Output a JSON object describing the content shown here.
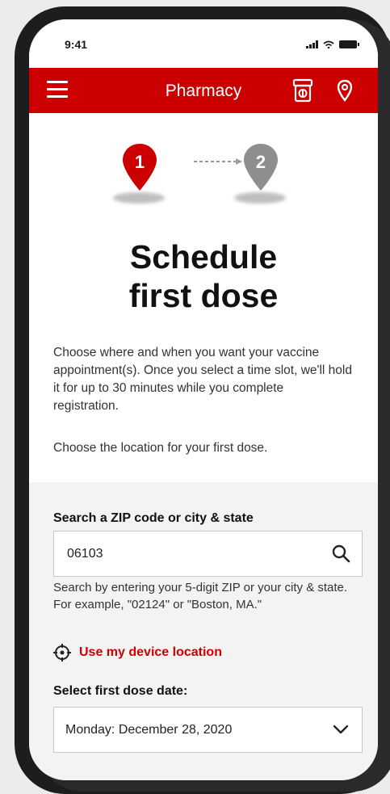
{
  "status_bar": {
    "time": "9:41"
  },
  "app_bar": {
    "title": "Pharmacy"
  },
  "steps": {
    "step1": "1",
    "step2": "2",
    "active_color": "#cc0000",
    "inactive_color": "#8e8e8e"
  },
  "page": {
    "heading_line1": "Schedule",
    "heading_line2": "first dose",
    "intro": "Choose where and when you want your vaccine appointment(s). Once you select a time slot, we'll hold it for up to 30 minutes while you complete registration.",
    "choose_location": "Choose the location for your first dose."
  },
  "search": {
    "label": "Search a ZIP code or city & state",
    "value": "06103",
    "help": "Search by entering your 5-digit ZIP or your city & state. For example, \"02124\" or \"Boston, MA.\"",
    "device_location": "Use my device location"
  },
  "date": {
    "label": "Select first dose date:",
    "value": "Monday: December 28, 2020"
  },
  "colors": {
    "brand": "#cc0000"
  }
}
